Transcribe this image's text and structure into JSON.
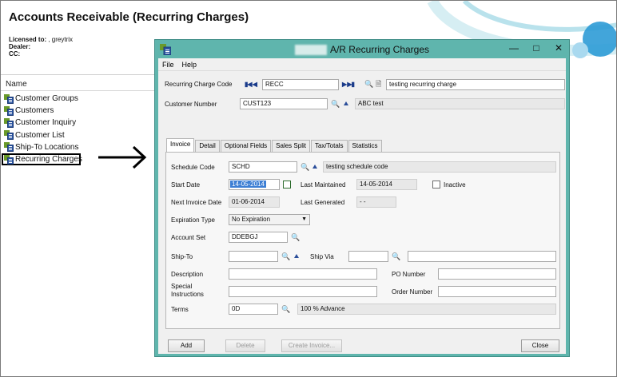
{
  "background": {
    "title": "Accounts Receivable (Recurring Charges)",
    "licensed_to_label": "Licensed to:",
    "licensed_to_value": ", greytrix",
    "dealer_label": "Dealer:",
    "cc_label": "CC:",
    "list_header": "Name",
    "tree_items": [
      "Customer Groups",
      "Customers",
      "Customer Inquiry",
      "Customer List",
      "Ship-To Locations",
      "Recurring Charges"
    ]
  },
  "dialog": {
    "title": "A/R Recurring Charges",
    "menu": [
      "File",
      "Help"
    ],
    "recurring_charge_code_label": "Recurring Charge Code",
    "recurring_charge_code": "RECC",
    "recurring_charge_desc": "testing recurring charge",
    "customer_number_label": "Customer Number",
    "customer_number": "CUST123",
    "customer_name": "ABC test",
    "tabs": [
      "Invoice",
      "Detail",
      "Optional Fields",
      "Sales Split",
      "Tax/Totals",
      "Statistics"
    ],
    "invoice": {
      "schedule_code_label": "Schedule Code",
      "schedule_code": "SCHD",
      "schedule_desc": "testing schedule code",
      "start_date_label": "Start Date",
      "start_date": "14-05-2014",
      "last_maintained_label": "Last Maintained",
      "last_maintained": "14-05-2014",
      "inactive_label": "Inactive",
      "next_invoice_date_label": "Next Invoice Date",
      "next_invoice_date": "01-06-2014",
      "last_generated_label": "Last Generated",
      "last_generated": "-   -",
      "expiration_type_label": "Expiration Type",
      "expiration_type": "No Expiration",
      "account_set_label": "Account Set",
      "account_set": "DDEBGJ",
      "ship_to_label": "Ship-To",
      "ship_via_label": "Ship Via",
      "description_label": "Description",
      "po_number_label": "PO Number",
      "special_instructions_label_1": "Special",
      "special_instructions_label_2": "Instructions",
      "order_number_label": "Order Number",
      "terms_label": "Terms",
      "terms": "0D",
      "terms_desc": "100 % Advance"
    },
    "buttons": {
      "add": "Add",
      "delete": "Delete",
      "create_invoice": "Create Invoice...",
      "close": "Close"
    }
  },
  "colors": {
    "dialog_frame": "#5fb5ad",
    "selection": "#3d7fd4"
  }
}
